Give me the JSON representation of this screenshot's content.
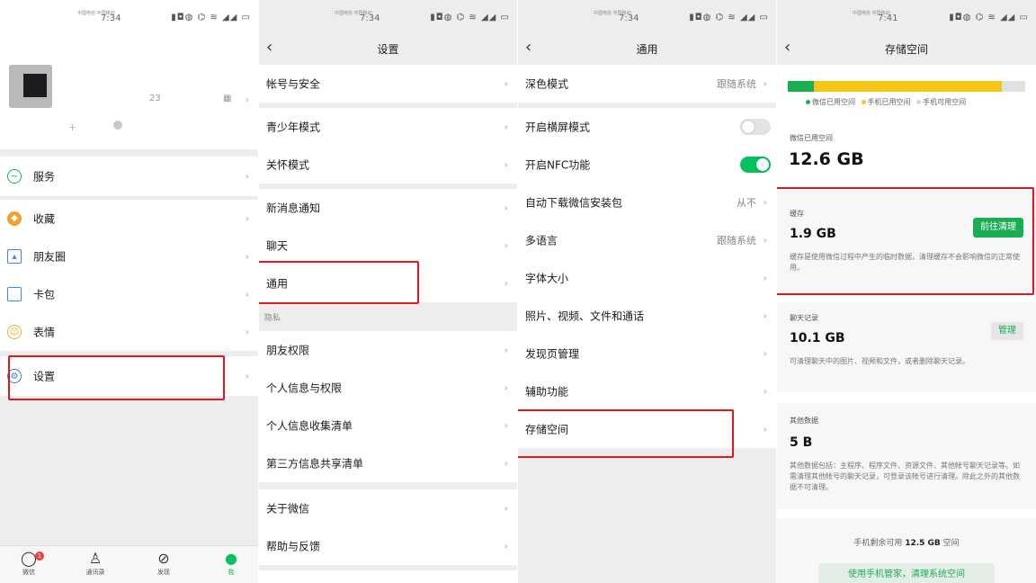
{
  "colors": {
    "accent_green": "#07c160",
    "highlight_red": "#e0191e",
    "storage_yellow": "#f5c518",
    "storage_green": "#1aad54",
    "storage_gray": "#e1e1e1"
  },
  "panel1": {
    "status": {
      "time": "7:34",
      "carrier": "中国电信 中国移动"
    },
    "profile": {
      "number": "23"
    },
    "items": [
      {
        "label": "服务",
        "icon": "service-icon"
      },
      {
        "label": "收藏",
        "icon": "favorites-icon"
      },
      {
        "label": "朋友圈",
        "icon": "moments-icon"
      },
      {
        "label": "卡包",
        "icon": "cards-icon"
      },
      {
        "label": "表情",
        "icon": "sticker-icon"
      },
      {
        "label": "设置",
        "icon": "settings-icon"
      }
    ],
    "tabs": [
      {
        "label": "微信",
        "icon": "chat-icon",
        "badge": "1"
      },
      {
        "label": "通讯录",
        "icon": "contacts-icon"
      },
      {
        "label": "发现",
        "icon": "discover-icon"
      },
      {
        "label": "我",
        "icon": "me-icon"
      }
    ]
  },
  "panel2": {
    "status": {
      "time": "7:34",
      "carrier": "中国电信 中国移动"
    },
    "title": "设置",
    "items": [
      "帐号与安全",
      "青少年模式",
      "关怀模式",
      "新消息通知",
      "聊天",
      "通用",
      "朋友权限",
      "个人信息与权限",
      "个人信息收集清单",
      "第三方信息共享清单",
      "关于微信",
      "帮助与反馈"
    ],
    "privacy_label": "隐私"
  },
  "panel3": {
    "status": {
      "time": "7:34",
      "carrier": "中国电信 中国移动"
    },
    "title": "通用",
    "items": [
      {
        "label": "深色模式",
        "value": "跟随系统"
      },
      {
        "label": "开启横屏模式",
        "toggle": false
      },
      {
        "label": "开启NFC功能",
        "toggle": true
      },
      {
        "label": "自动下载微信安装包",
        "value": "从不"
      },
      {
        "label": "多语言",
        "value": "跟随系统"
      },
      {
        "label": "字体大小"
      },
      {
        "label": "照片、视频、文件和通话"
      },
      {
        "label": "发现页管理"
      },
      {
        "label": "辅助功能"
      },
      {
        "label": "存储空间"
      }
    ]
  },
  "panel4": {
    "status": {
      "time": "7:41",
      "carrier": "中国电信 中国移动"
    },
    "title": "存储空间",
    "bar": {
      "wechat_fraction": 0.11,
      "phone_used_fraction": 0.79
    },
    "legend": [
      "微信已用空间",
      "手机已用空间",
      "手机可用空间"
    ],
    "used_title": "微信已用空间",
    "used_size": "12.6 GB",
    "cache": {
      "title": "缓存",
      "size": "1.9 GB",
      "button": "前往清理",
      "desc": "缓存是使用微信过程中产生的临时数据，清理缓存不会影响微信的正常使用。"
    },
    "chat": {
      "title": "聊天记录",
      "size": "10.1 GB",
      "button": "管理",
      "desc": "可清理聊天中的图片、视频和文件，或者删除聊天记录。"
    },
    "other": {
      "title": "其他数据",
      "size": "5 B",
      "desc": "其他数据包括：主程序、程序文件、资源文件、其他帐号聊天记录等。如需清理其他帐号的聊天记录，可登录该帐号进行清理。除此之外的其他数据不可清理。"
    },
    "remaining": {
      "text_before": "手机剩余可用",
      "size": "12.5 GB",
      "text_after": "空间"
    },
    "system_button": "使用手机管家，清理系统空间"
  }
}
